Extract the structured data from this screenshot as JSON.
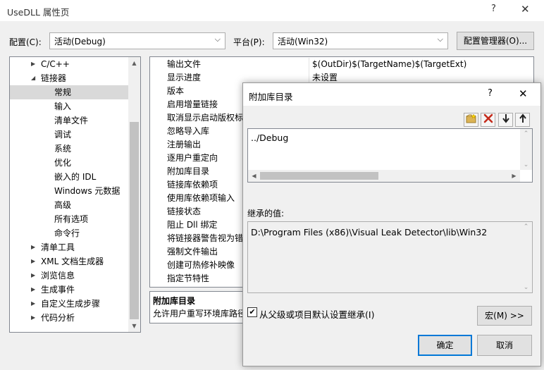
{
  "window": {
    "title": "UseDLL 属性页",
    "help_glyph": "?",
    "close_glyph": "✕"
  },
  "config": {
    "config_label": "配置(C):",
    "config_value": "活动(Debug)",
    "platform_label": "平台(P):",
    "platform_value": "活动(Win32)",
    "manager_button": "配置管理器(O)..."
  },
  "tree": {
    "items": [
      {
        "label": "C/C++",
        "expander": "▶"
      },
      {
        "label": "链接器",
        "expander": "◢"
      },
      {
        "label": "常规",
        "expander": ""
      },
      {
        "label": "输入",
        "expander": ""
      },
      {
        "label": "清单文件",
        "expander": ""
      },
      {
        "label": "调试",
        "expander": ""
      },
      {
        "label": "系统",
        "expander": ""
      },
      {
        "label": "优化",
        "expander": ""
      },
      {
        "label": "嵌入的 IDL",
        "expander": ""
      },
      {
        "label": "Windows 元数据",
        "expander": ""
      },
      {
        "label": "高级",
        "expander": ""
      },
      {
        "label": "所有选项",
        "expander": ""
      },
      {
        "label": "命令行",
        "expander": ""
      },
      {
        "label": "清单工具",
        "expander": "▶"
      },
      {
        "label": "XML 文档生成器",
        "expander": "▶"
      },
      {
        "label": "浏览信息",
        "expander": "▶"
      },
      {
        "label": "生成事件",
        "expander": "▶"
      },
      {
        "label": "自定义生成步骤",
        "expander": "▶"
      },
      {
        "label": "代码分析",
        "expander": "▶"
      }
    ]
  },
  "grid": {
    "rows": [
      {
        "name": "输出文件",
        "value": "$(OutDir)$(TargetName)$(TargetExt)"
      },
      {
        "name": "显示进度",
        "value": "未设置"
      },
      {
        "name": "版本",
        "value": ""
      },
      {
        "name": "启用增量链接",
        "value": ""
      },
      {
        "name": "取消显示启动版权标",
        "value": ""
      },
      {
        "name": "忽略导入库",
        "value": ""
      },
      {
        "name": "注册输出",
        "value": ""
      },
      {
        "name": "逐用户重定向",
        "value": ""
      },
      {
        "name": "附加库目录",
        "value": ""
      },
      {
        "name": "链接库依赖项",
        "value": ""
      },
      {
        "name": "使用库依赖项输入",
        "value": ""
      },
      {
        "name": "链接状态",
        "value": ""
      },
      {
        "name": "阻止 Dll 绑定",
        "value": ""
      },
      {
        "name": "将链接器警告视为错",
        "value": ""
      },
      {
        "name": "强制文件输出",
        "value": ""
      },
      {
        "name": "创建可热修补映像",
        "value": ""
      },
      {
        "name": "指定节特性",
        "value": ""
      }
    ]
  },
  "description": {
    "heading": "附加库目录",
    "text": "允许用户重写环境库路径"
  },
  "dialog": {
    "title": "附加库目录",
    "help_glyph": "?",
    "close_glyph": "✕",
    "entry": "../Debug",
    "inherited_label": "继承的值:",
    "inherited_value": "D:\\Program Files (x86)\\Visual Leak Detector\\lib\\Win32",
    "inherit_checkbox_label": "从父级或项目默认设置继承(I)",
    "inherit_checked": true,
    "macro_button": "宏(M) >>",
    "ok_button": "确定",
    "cancel_button": "取消",
    "toolbar_icons": [
      "new-line-icon",
      "delete-icon",
      "move-down-icon",
      "move-up-icon"
    ]
  },
  "colors": {
    "primary_border": "#0078d7",
    "delete_icon": "#c42b1c",
    "folder_icon": "#dcb455"
  }
}
